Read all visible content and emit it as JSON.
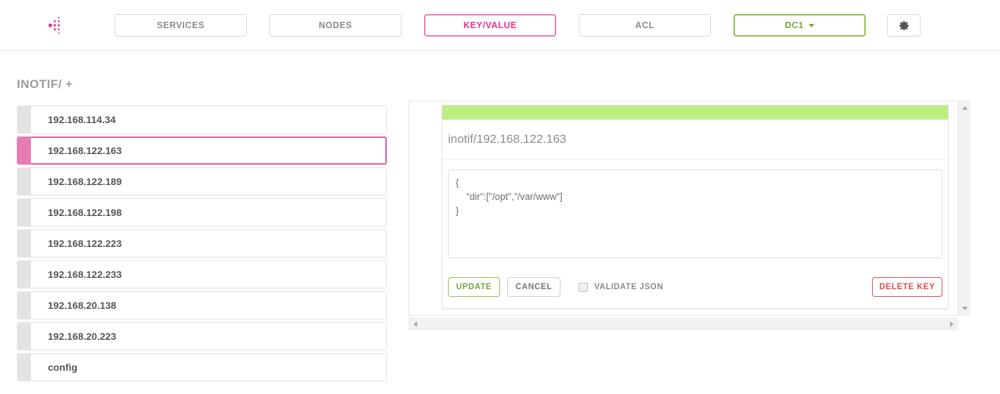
{
  "colors": {
    "brand_pink": "#e8328c",
    "accent_pink": "#e87cb0",
    "accent_green": "#73a839",
    "strip_green": "#bdee82",
    "danger_red": "#e04a4a",
    "muted_gray": "#8a8a8a"
  },
  "navbar": {
    "logo_icon": "consul-logo-icon",
    "items": [
      {
        "label": "SERVICES",
        "state": "default"
      },
      {
        "label": "NODES",
        "state": "default"
      },
      {
        "label": "KEY/VALUE",
        "state": "active"
      },
      {
        "label": "ACL",
        "state": "default"
      }
    ],
    "datacenter": {
      "label": "DC1",
      "caret_icon": "chevron-down-icon"
    },
    "settings": {
      "icon": "gear-icon"
    }
  },
  "breadcrumb": {
    "text": "INOTIF/ +"
  },
  "key_list": {
    "items": [
      {
        "label": "192.168.114.34",
        "selected": false
      },
      {
        "label": "192.168.122.163",
        "selected": true
      },
      {
        "label": "192.168.122.189",
        "selected": false
      },
      {
        "label": "192.168.122.198",
        "selected": false
      },
      {
        "label": "192.168.122.223",
        "selected": false
      },
      {
        "label": "192.168.122.233",
        "selected": false
      },
      {
        "label": "192.168.20.138",
        "selected": false
      },
      {
        "label": "192.168.20.223",
        "selected": false
      },
      {
        "label": "config",
        "selected": false
      }
    ]
  },
  "detail": {
    "key_name": "inotif/192.168.122.163",
    "value": "{\n    \"dir\":[\"/opt\",\"/var/www\"]\n}",
    "actions": {
      "update_label": "UPDATE",
      "cancel_label": "CANCEL",
      "validate_label": "VALIDATE JSON",
      "validate_checked": false,
      "delete_label": "DELETE KEY"
    }
  },
  "scrollbars": {
    "vertical": {
      "up_icon": "scroll-up-arrow-icon",
      "down_icon": "scroll-down-arrow-icon"
    },
    "horizontal": {
      "left_icon": "scroll-left-arrow-icon",
      "right_icon": "scroll-right-arrow-icon"
    }
  }
}
